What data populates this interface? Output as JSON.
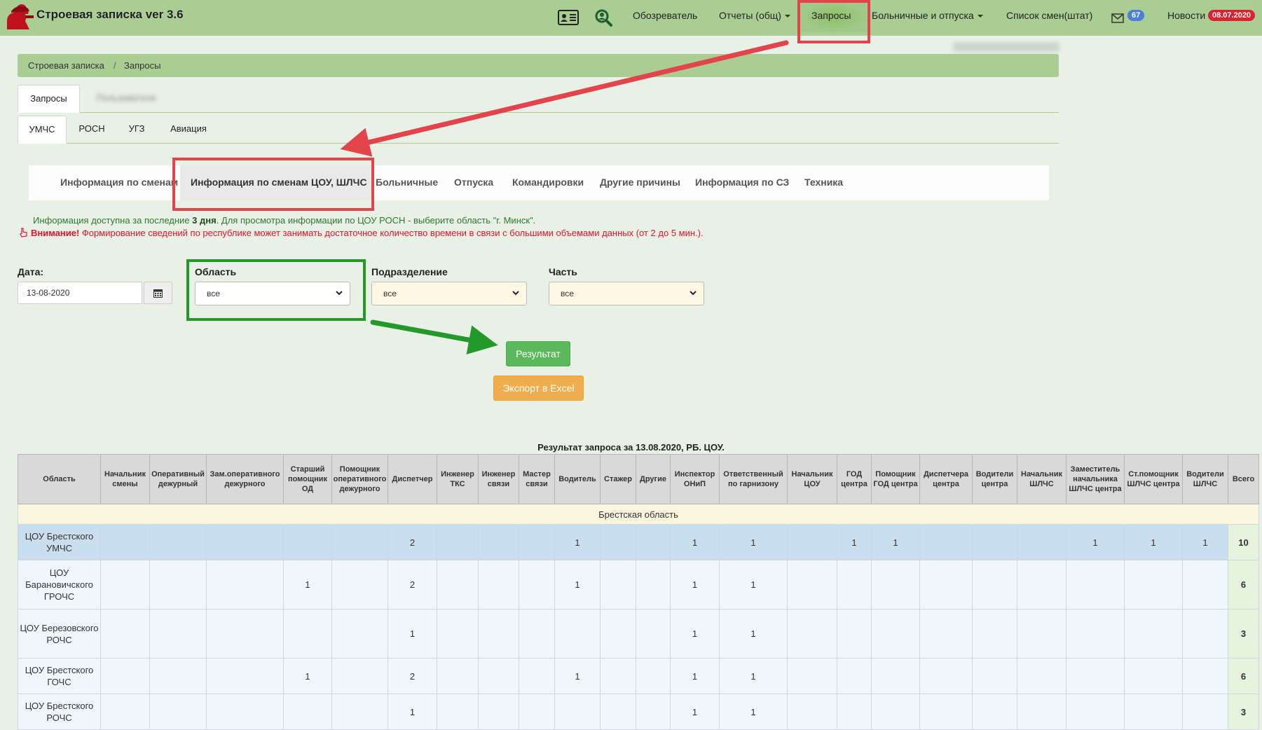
{
  "app": {
    "title": "Строевая записка ver 3.6"
  },
  "navbar": {
    "items": [
      {
        "label": "Обозреватель"
      },
      {
        "label": "Отчеты (общ)"
      },
      {
        "label": "Запросы"
      },
      {
        "label": "Больничные и отпуска"
      },
      {
        "label": "Список смен(штат)"
      },
      {
        "label": "Новости"
      }
    ],
    "mail_count": "67",
    "news_date": "08.07.2020"
  },
  "breadcrumb": {
    "root": "Строевая записка",
    "separator": "/",
    "current": "Запросы"
  },
  "tabs": {
    "primary": [
      "Запросы",
      "Пользователи"
    ],
    "secondary": [
      "УМЧС",
      "РОСН",
      "УГЗ",
      "Авиация"
    ]
  },
  "subtabs": [
    "Информация по сменам",
    "Информация по сменам ЦОУ, ШЛЧС",
    "Больничные",
    "Отпуска",
    "Командировки",
    "Другие причины",
    "Информация по СЗ",
    "Техника"
  ],
  "info": {
    "line1_prefix": "Информация доступна за последние ",
    "line1_bold": "3 дня",
    "line1_suffix": ". Для просмотра информации по ЦОУ РОСН - выберите область \"г. Минск\".",
    "line2_bold": "Внимание!",
    "line2_text": " Формирование сведений по республике может занимать достаточное количество времени в связи с большими объемами данных (от 2 до 5 мин.)."
  },
  "form": {
    "date_label": "Дата:",
    "date_value": "13-08-2020",
    "region_label": "Область",
    "region_value": "все",
    "division_label": "Подразделение",
    "division_value": "все",
    "unit_label": "Часть",
    "unit_value": "все",
    "result_button": "Результат",
    "export_button": "Экспорт в Excel"
  },
  "colors": {
    "navbar": "#a9cd92",
    "result_button": "#5cb85c",
    "export_button": "#f0ad4e",
    "annotation_red": "#e3444c",
    "annotation_green": "#22992a",
    "badge_blue": "#4a7fd6",
    "badge_red": "#d9232e"
  },
  "table": {
    "caption": "Результат запроса за 13.08.2020, РБ. ЦОУ.",
    "headers": [
      "Область",
      "Начальник смены",
      "Оперативный дежурный",
      "Зам.оперативного дежурного",
      "Старший помощник ОД",
      "Помощник оперативного дежурного",
      "Диспетчер",
      "Инженер ТКС",
      "Инженер связи",
      "Мастер связи",
      "Водитель",
      "Стажер",
      "Другие",
      "Инспектор ОНиП",
      "Ответственный по гарнизону",
      "Начальник ЦОУ",
      "ГОД центра",
      "Помощник ГОД центра",
      "Диспетчера центра",
      "Водители центра",
      "Начальник ШЛЧС",
      "Заместитель начальника ШЛЧС центра",
      "Ст.помощник ШЛЧС центра",
      "Водители ШЛЧС",
      "Всего"
    ],
    "group": "Брестская область",
    "rows": [
      {
        "name": "ЦОУ Брестского УМЧС",
        "cells": [
          "",
          "",
          "",
          "",
          "",
          "2",
          "",
          "",
          "",
          "1",
          "",
          "",
          "1",
          "1",
          "",
          "1",
          "1",
          "",
          "",
          "",
          "1",
          "1",
          "1"
        ],
        "total": "10"
      },
      {
        "name": "ЦОУ Барановичского ГРОЧС",
        "cells": [
          "",
          "",
          "",
          "1",
          "",
          "2",
          "",
          "",
          "",
          "1",
          "",
          "",
          "1",
          "1",
          "",
          "",
          "",
          "",
          "",
          "",
          "",
          "",
          ""
        ],
        "total": "6"
      },
      {
        "name": "ЦОУ Березовского РОЧС",
        "cells": [
          "",
          "",
          "",
          "",
          "",
          "1",
          "",
          "",
          "",
          "",
          "",
          "",
          "1",
          "1",
          "",
          "",
          "",
          "",
          "",
          "",
          "",
          "",
          ""
        ],
        "total": "3"
      },
      {
        "name": "ЦОУ Брестского ГОЧС",
        "cells": [
          "",
          "",
          "",
          "1",
          "",
          "2",
          "",
          "",
          "",
          "1",
          "",
          "",
          "1",
          "1",
          "",
          "",
          "",
          "",
          "",
          "",
          "",
          "",
          ""
        ],
        "total": "6"
      },
      {
        "name": "ЦОУ Брестского РОЧС",
        "cells": [
          "",
          "",
          "",
          "",
          "",
          "1",
          "",
          "",
          "",
          "",
          "",
          "",
          "1",
          "1",
          "",
          "",
          "",
          "",
          "",
          "",
          "",
          "",
          ""
        ],
        "total": "3"
      }
    ]
  }
}
